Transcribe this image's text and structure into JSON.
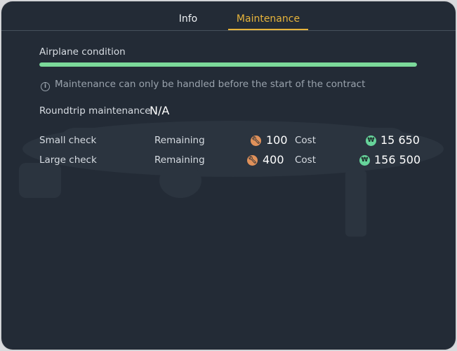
{
  "tabs": [
    {
      "label": "Info",
      "active": false
    },
    {
      "label": "Maintenance",
      "active": true
    }
  ],
  "colors": {
    "accent": "#e7b43b",
    "condition_bar": "#7bd99a",
    "wrench": "#e0915a",
    "coin": "#66d39a",
    "panel_bg": "#232b36"
  },
  "condition": {
    "label": "Airplane condition",
    "level": 1.0
  },
  "note": {
    "icon": "info-icon",
    "text": "Maintenance can only be handled before the start of the contract"
  },
  "roundtrip": {
    "label": "Roundtrip maintenance",
    "value": "N/A"
  },
  "checks": [
    {
      "name": "Small check",
      "remaining_label": "Remaining",
      "remaining_icon": "wrench-icon",
      "remaining_value": "100",
      "cost_label": "Cost",
      "cost_icon": "coin-icon",
      "cost_value": "15 650"
    },
    {
      "name": "Large check",
      "remaining_label": "Remaining",
      "remaining_icon": "wrench-icon",
      "remaining_value": "400",
      "cost_label": "Cost",
      "cost_icon": "coin-icon",
      "cost_value": "156 500"
    }
  ]
}
